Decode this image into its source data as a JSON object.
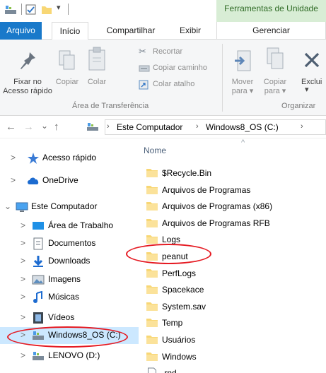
{
  "titlebar": {
    "context_tab": "Ferramentas de Unidade"
  },
  "tabs": {
    "arquivo": "Arquivo",
    "inicio": "Início",
    "compartilhar": "Compartilhar",
    "exibir": "Exibir",
    "gerenciar": "Gerenciar"
  },
  "ribbon": {
    "fixar_no": "Fixar no",
    "acesso_rapido": "Acesso rápido",
    "copiar": "Copiar",
    "colar": "Colar",
    "recortar": "Recortar",
    "copiar_caminho": "Copiar caminho",
    "colar_atalho": "Colar atalho",
    "group_clipboard": "Área de Transferência",
    "mover": "Mover",
    "mover_para": "para ▾",
    "copiar2": "Copiar",
    "copiar_para": "para ▾",
    "excluir": "Exclui",
    "excluir_arrow": "▾",
    "group_organizar": "Organizar"
  },
  "address": {
    "back": "←",
    "forward": "→",
    "recent": "⌄",
    "up": "↑",
    "crumb_sep1": "›",
    "crumb1": "Este Computador",
    "crumb_sep2": "›",
    "crumb2": "Windows8_OS (C:)",
    "crumb_sep3": "›"
  },
  "nav": {
    "items": [
      {
        "label": "Acesso rápido",
        "chev": ">",
        "icon": "star-icon"
      },
      {
        "label": "OneDrive",
        "chev": ">",
        "icon": "cloud-icon"
      },
      {
        "label": "Este Computador",
        "chev": "⌄",
        "icon": "computer-icon"
      },
      {
        "label": "Área de Trabalho",
        "chev": ">",
        "icon": "desktop-icon"
      },
      {
        "label": "Documentos",
        "chev": ">",
        "icon": "document-icon"
      },
      {
        "label": "Downloads",
        "chev": ">",
        "icon": "download-icon"
      },
      {
        "label": "Imagens",
        "chev": ">",
        "icon": "image-icon"
      },
      {
        "label": "Músicas",
        "chev": ">",
        "icon": "music-icon"
      },
      {
        "label": "Vídeos",
        "chev": ">",
        "icon": "video-icon"
      },
      {
        "label": "Windows8_OS (C:)",
        "chev": ">",
        "icon": "drive-icon"
      },
      {
        "label": "LENOVO (D:)",
        "chev": ">",
        "icon": "drive-icon"
      }
    ]
  },
  "list": {
    "column_name": "Nome",
    "sort_arrow": "^",
    "files": [
      {
        "name": "$Recycle.Bin",
        "type": "folder"
      },
      {
        "name": "Arquivos de Programas",
        "type": "folder"
      },
      {
        "name": "Arquivos de Programas (x86)",
        "type": "folder"
      },
      {
        "name": "Arquivos de Programas RFB",
        "type": "folder"
      },
      {
        "name": "Logs",
        "type": "folder"
      },
      {
        "name": "peanut",
        "type": "folder"
      },
      {
        "name": "PerfLogs",
        "type": "folder"
      },
      {
        "name": "Spacekace",
        "type": "folder"
      },
      {
        "name": "System.sav",
        "type": "folder"
      },
      {
        "name": "Temp",
        "type": "folder"
      },
      {
        "name": "Usuários",
        "type": "folder"
      },
      {
        "name": "Windows",
        "type": "folder"
      },
      {
        "name": ".rnd",
        "type": "file"
      }
    ]
  },
  "colors": {
    "accent": "#1979ca",
    "folder": "#f8d775",
    "highlight": "#e51a22",
    "selection": "#cce8ff"
  }
}
